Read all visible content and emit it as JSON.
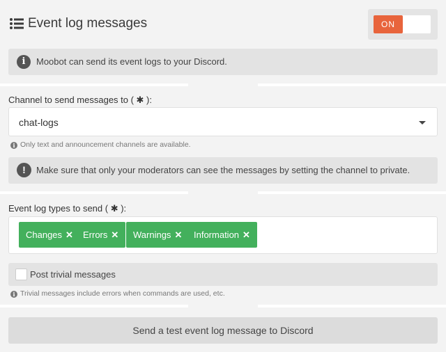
{
  "header": {
    "title": "Event log messages",
    "title_icon": "list-icon",
    "toggle_label": "ON",
    "toggle_state": "on"
  },
  "info": {
    "icon": "info-icon",
    "text": "Moobot can send its event logs to your Discord."
  },
  "channel": {
    "label": "Channel to send messages to ( ✱ ):",
    "value": "chat-logs",
    "hint": "Only text and announcement channels are available."
  },
  "warning": {
    "icon": "exclamation-icon",
    "text": "Make sure that only your moderators can see the messages by setting the channel to private."
  },
  "types": {
    "label": "Event log types to send ( ✱ ):",
    "tags": [
      "Changes",
      "Errors",
      "Warnings",
      "Information"
    ]
  },
  "trivial": {
    "label": "Post trivial messages",
    "checked": false,
    "hint": "Trivial messages include errors when commands are used, etc."
  },
  "test_button": "Send a test event log message to Discord",
  "colors": {
    "accent": "#e8643c",
    "tag": "#43b05c"
  }
}
